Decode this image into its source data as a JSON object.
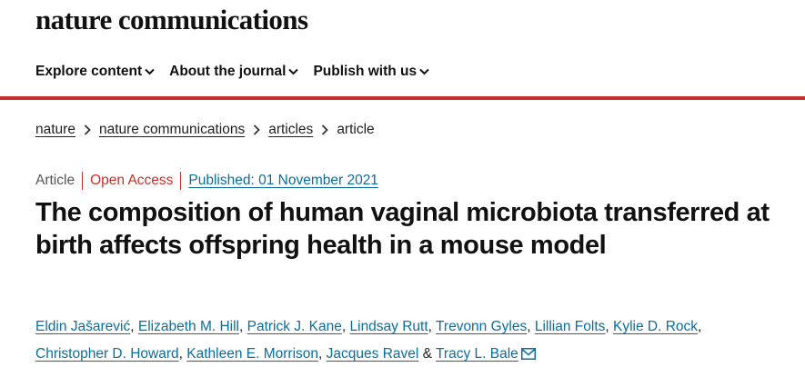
{
  "site": {
    "logo": "nature communications"
  },
  "nav": {
    "items": [
      {
        "label": "Explore content"
      },
      {
        "label": "About the journal"
      },
      {
        "label": "Publish with us"
      }
    ]
  },
  "breadcrumb": {
    "items": [
      "nature",
      "nature communications",
      "articles"
    ],
    "current": "article"
  },
  "meta": {
    "type": "Article",
    "access": "Open Access",
    "published": "Published: 01 November 2021"
  },
  "article": {
    "title": "The composition of human vaginal microbiota transferred at birth affects offspring health in a mouse model"
  },
  "authors": {
    "list": [
      "Eldin Jašarević",
      "Elizabeth M. Hill",
      "Patrick J. Kane",
      "Lindsay Rutt",
      "Trevonn Gyles",
      "Lillian Folts",
      "Kylie D. Rock",
      "Christopher D. Howard",
      "Kathleen E. Morrison",
      "Jacques Ravel",
      "Tracy L. Bale"
    ],
    "comma": ",",
    "ampersand": "&"
  },
  "colors": {
    "accent": "#c3332a",
    "link": "#0a6ea0",
    "text": "#222222"
  },
  "icons": {
    "nav_chevron": "chevron-down-icon",
    "breadcrumb_sep": "chevron-right-icon",
    "corresponding": "envelope-icon"
  }
}
